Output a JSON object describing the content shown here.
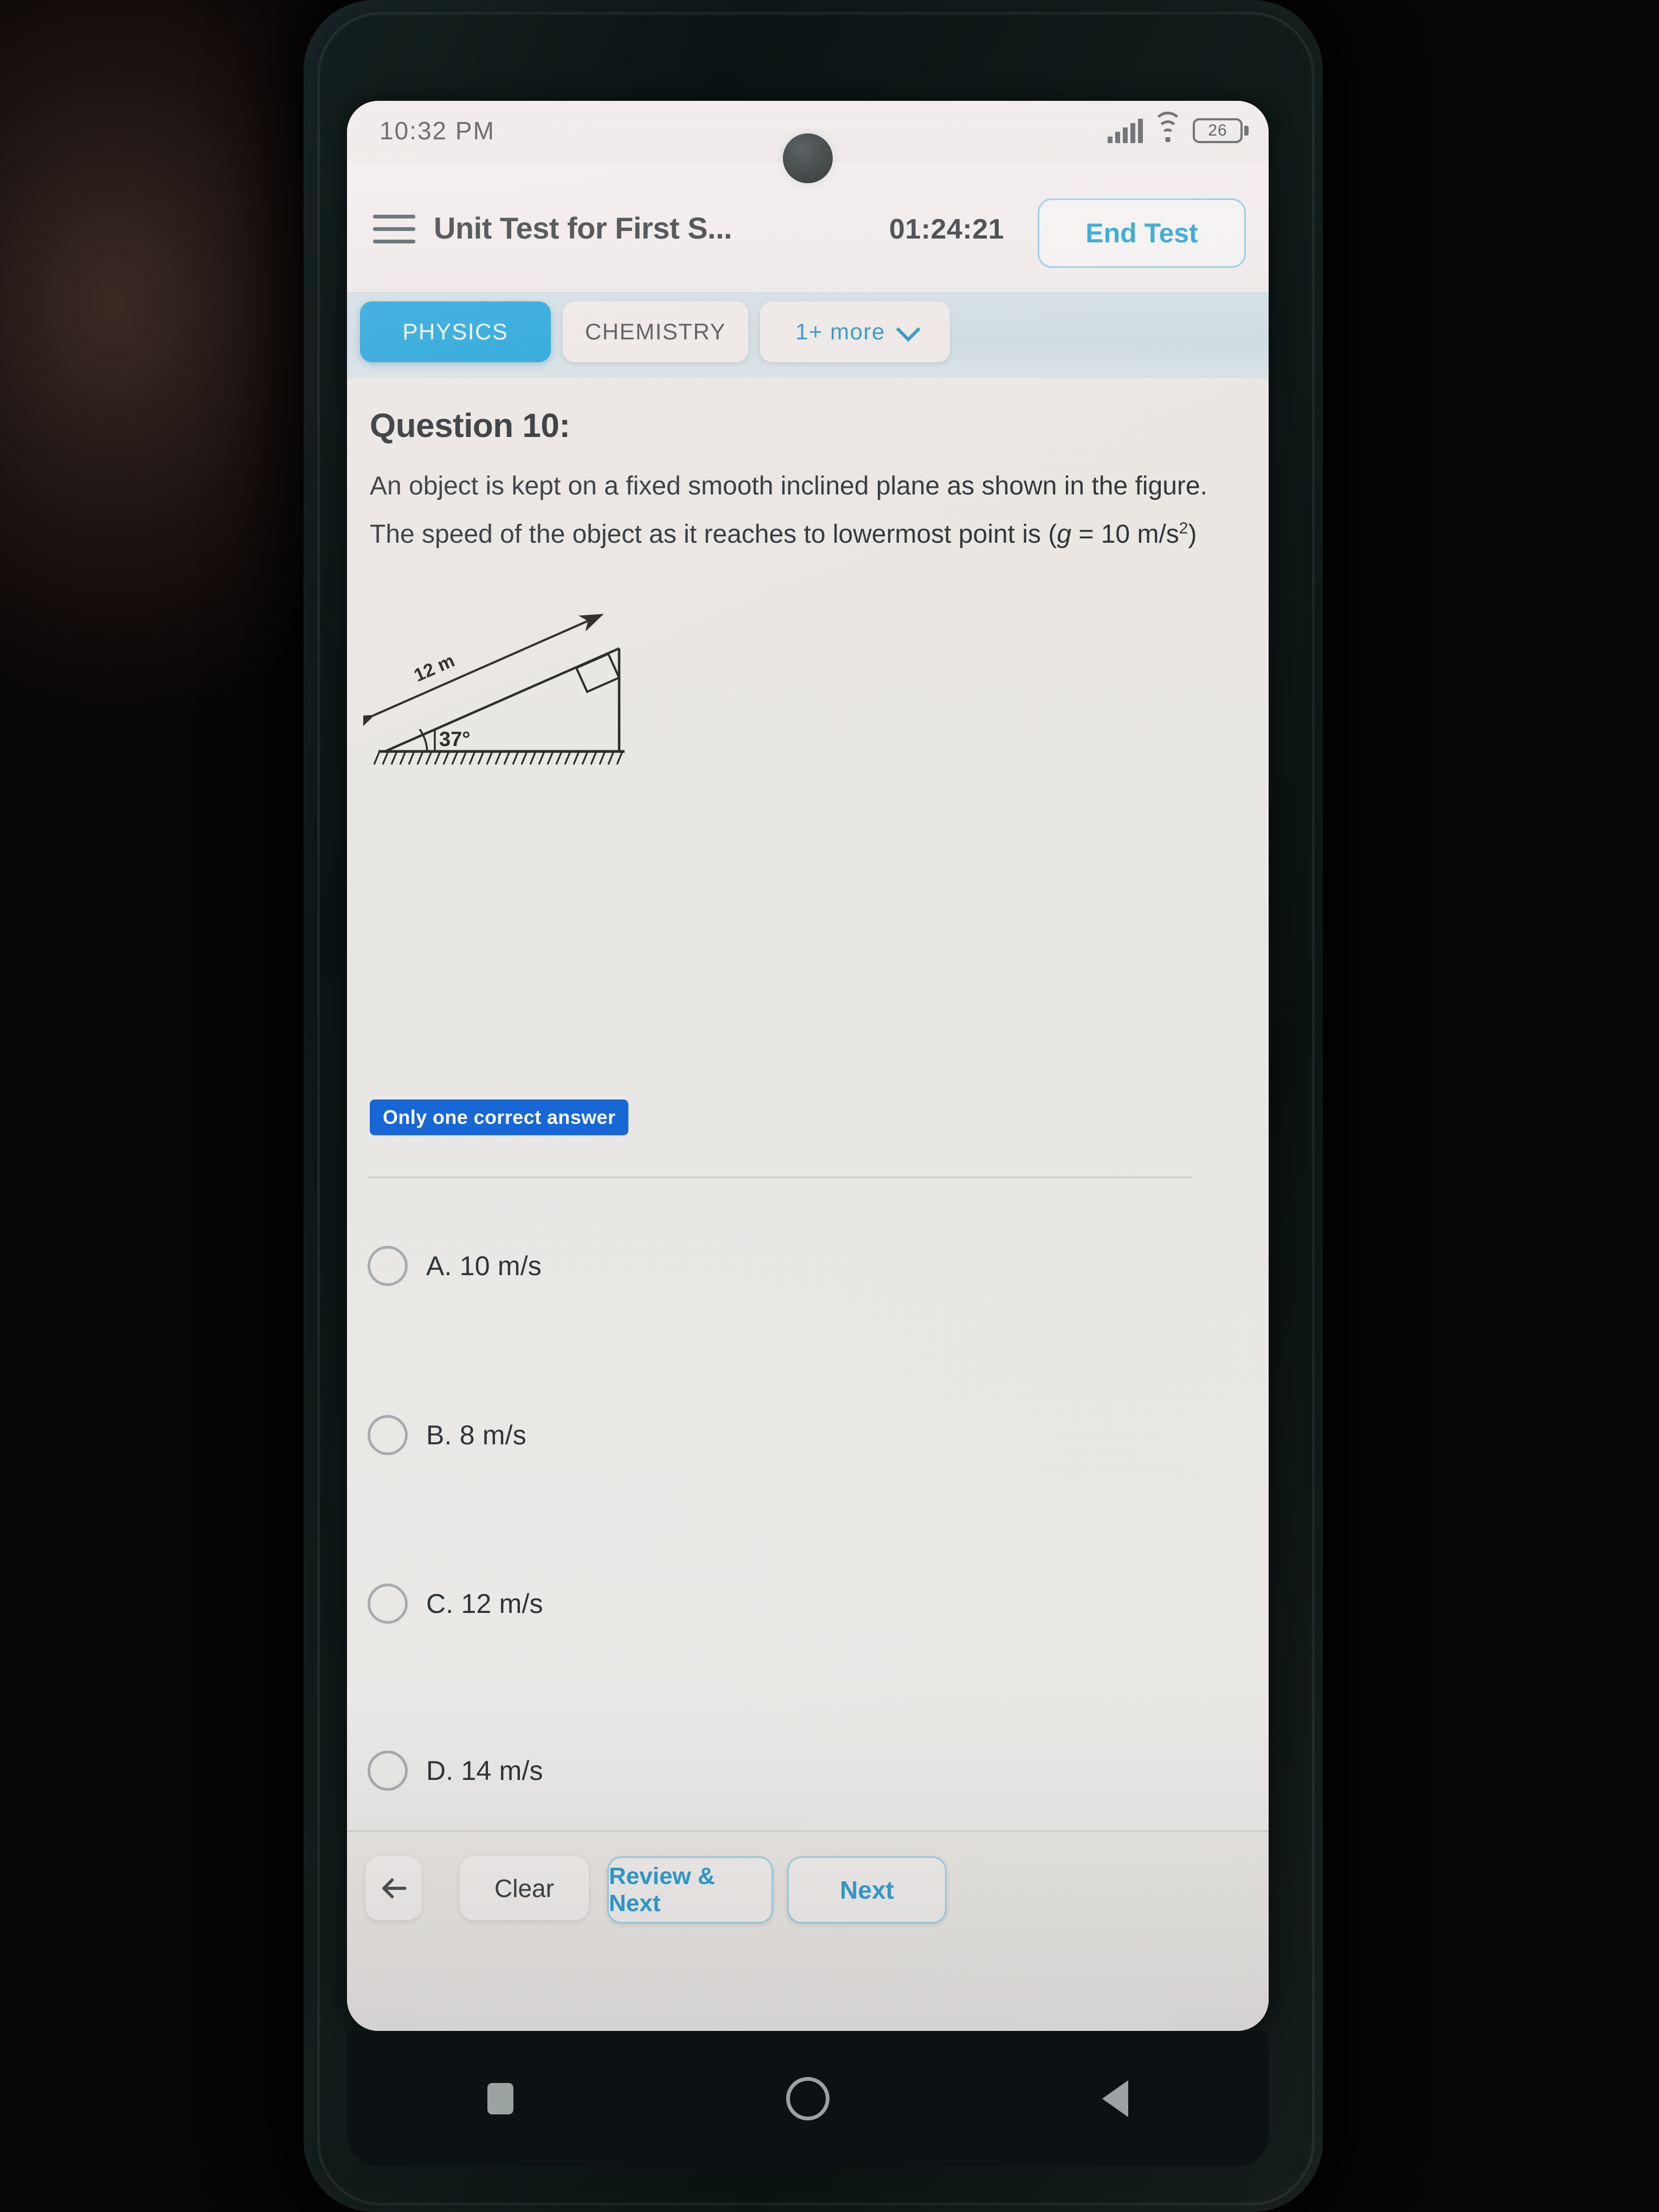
{
  "status_bar": {
    "time": "10:32 PM",
    "battery_level": "26",
    "icons": [
      "signal-icon",
      "wifi-icon",
      "battery-icon"
    ]
  },
  "header": {
    "menu_icon": "hamburger-menu-icon",
    "title": "Unit Test for First S...",
    "timer": "01:24:21",
    "end_test_label": "End Test"
  },
  "tabs": [
    {
      "label": "PHYSICS",
      "active": true
    },
    {
      "label": "CHEMISTRY",
      "active": false
    },
    {
      "label": "1+ more",
      "active": false,
      "icon": "chevron-down-icon"
    }
  ],
  "question": {
    "number_label": "Question 10:",
    "line1": "An object is kept on a fixed smooth inclined plane as shown in",
    "line2": "the figure. The speed of the object as it reaches to lowermost",
    "line3_prefix": "point is (",
    "line3_var": "g",
    "line3_suffix": " = 10 m/s",
    "line3_sup": "2",
    "line3_end": ")",
    "badge": "Only one correct answer"
  },
  "figure": {
    "name": "inclined-plane-diagram",
    "length_label": "12 m",
    "angle_label": "37°"
  },
  "options": [
    {
      "id": "A",
      "label": "A. 10 m/s",
      "selected": false
    },
    {
      "id": "B",
      "label": "B. 8 m/s",
      "selected": false
    },
    {
      "id": "C",
      "label": "C. 12 m/s",
      "selected": false
    },
    {
      "id": "D",
      "label": "D. 14 m/s",
      "selected": false
    }
  ],
  "bottom_bar": {
    "back_icon": "arrow-left-icon",
    "clear_label": "Clear",
    "review_next_label": "Review & Next",
    "next_label": "Next"
  },
  "nav_bar": {
    "recents_icon": "square-recents-icon",
    "home_icon": "circle-home-icon",
    "back_icon": "triangle-back-icon"
  },
  "colors": {
    "accent_blue": "#1aa5dd",
    "link_blue": "#2e9fd4",
    "badge_blue": "#1767d8",
    "tab_bg": "#cfdee3"
  }
}
